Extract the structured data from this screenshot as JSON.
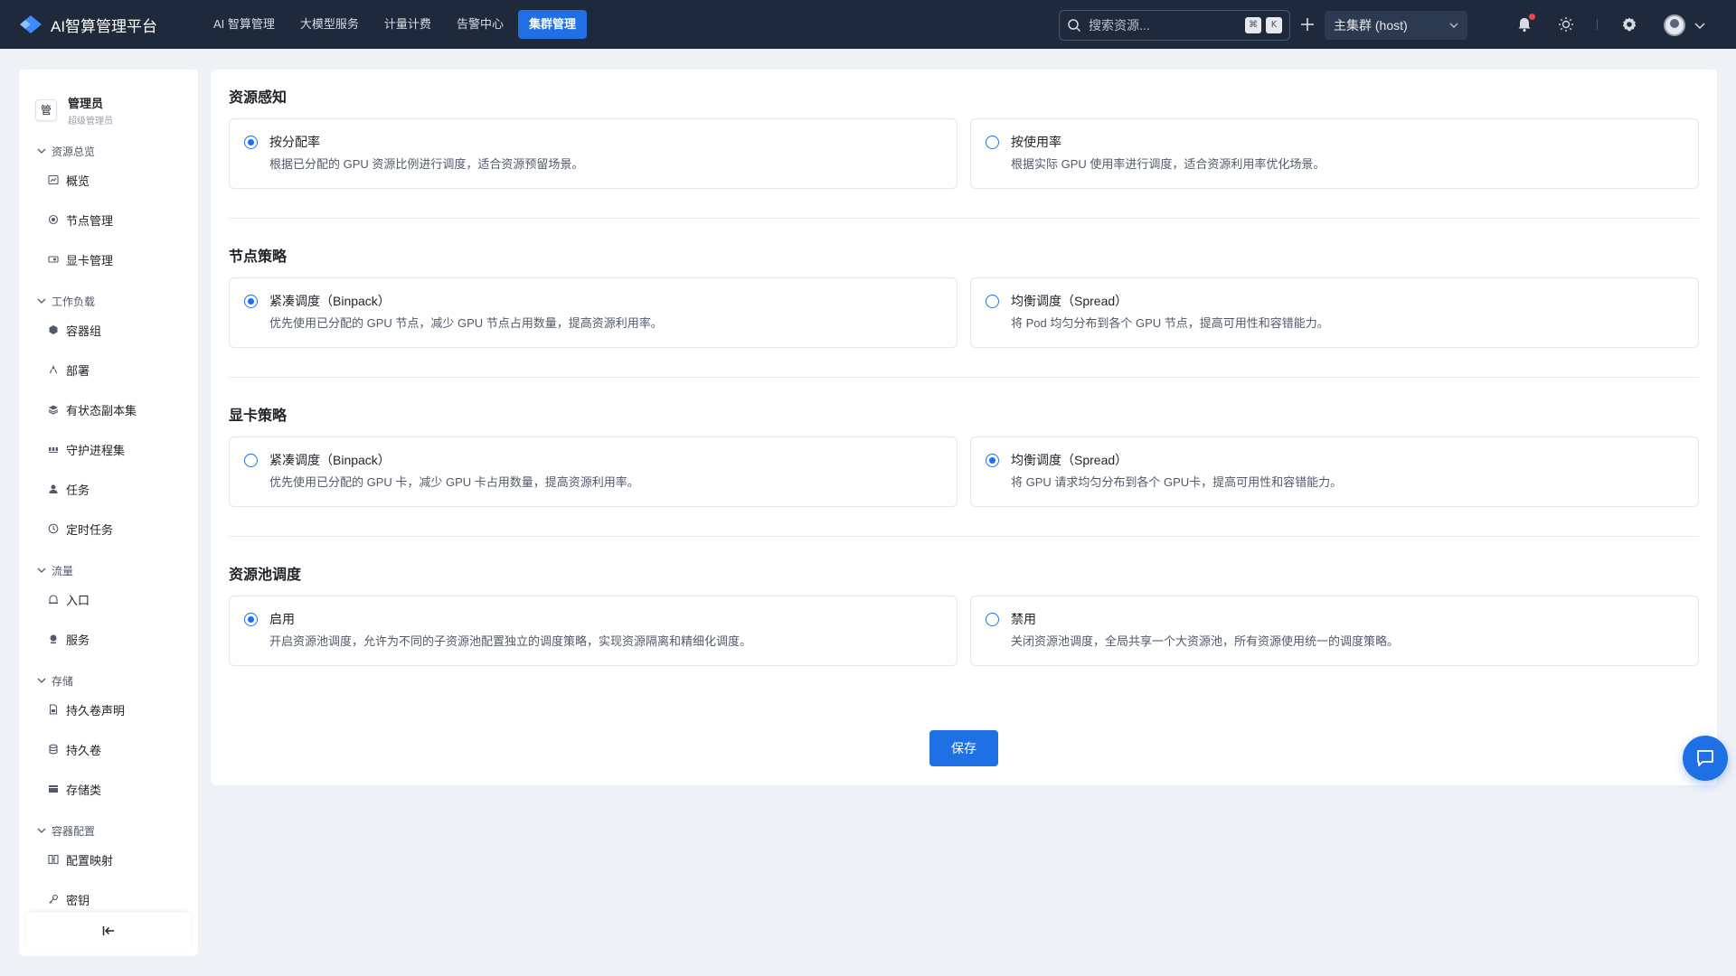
{
  "app": {
    "title": "AI智算管理平台"
  },
  "nav": [
    {
      "label": "AI 智算管理",
      "active": false
    },
    {
      "label": "大模型服务",
      "active": false
    },
    {
      "label": "计量计费",
      "active": false
    },
    {
      "label": "告警中心",
      "active": false
    },
    {
      "label": "集群管理",
      "active": true
    }
  ],
  "search": {
    "placeholder": "搜索资源...",
    "kbd1": "⌘",
    "kbd2": "K"
  },
  "cluster": {
    "selected": "主集群 (host)"
  },
  "user": {
    "avatar_text": "管",
    "name": "管理员",
    "role": "超级管理员"
  },
  "sidebar": {
    "groups": [
      {
        "title": "资源总览",
        "items": [
          {
            "label": "概览",
            "icon": "dashboard-icon"
          },
          {
            "label": "节点管理",
            "icon": "node-icon"
          },
          {
            "label": "显卡管理",
            "icon": "gpu-card-icon"
          }
        ]
      },
      {
        "title": "工作负载",
        "items": [
          {
            "label": "容器组",
            "icon": "cube-icon"
          },
          {
            "label": "部署",
            "icon": "rocket-icon"
          },
          {
            "label": "有状态副本集",
            "icon": "layers-icon"
          },
          {
            "label": "守护进程集",
            "icon": "daemon-icon"
          },
          {
            "label": "任务",
            "icon": "job-icon"
          },
          {
            "label": "定时任务",
            "icon": "clock-icon"
          }
        ]
      },
      {
        "title": "流量",
        "items": [
          {
            "label": "入口",
            "icon": "ingress-icon"
          },
          {
            "label": "服务",
            "icon": "service-icon"
          }
        ]
      },
      {
        "title": "存储",
        "items": [
          {
            "label": "持久卷声明",
            "icon": "pvc-icon"
          },
          {
            "label": "持久卷",
            "icon": "database-icon"
          },
          {
            "label": "存储类",
            "icon": "storage-class-icon"
          }
        ]
      },
      {
        "title": "容器配置",
        "items": [
          {
            "label": "配置映射",
            "icon": "configmap-icon"
          },
          {
            "label": "密钥",
            "icon": "key-icon"
          }
        ]
      }
    ]
  },
  "sections": [
    {
      "title": "资源感知",
      "options": [
        {
          "title": "按分配率",
          "desc": "根据已分配的 GPU 资源比例进行调度，适合资源预留场景。",
          "checked": true
        },
        {
          "title": "按使用率",
          "desc": "根据实际 GPU 使用率进行调度，适合资源利用率优化场景。",
          "checked": false
        }
      ]
    },
    {
      "title": "节点策略",
      "options": [
        {
          "title": "紧凑调度（Binpack）",
          "desc": "优先使用已分配的 GPU 节点，减少 GPU 节点占用数量，提高资源利用率。",
          "checked": true
        },
        {
          "title": "均衡调度（Spread）",
          "desc": "将 Pod 均匀分布到各个 GPU 节点，提高可用性和容错能力。",
          "checked": false
        }
      ]
    },
    {
      "title": "显卡策略",
      "options": [
        {
          "title": "紧凑调度（Binpack）",
          "desc": "优先使用已分配的 GPU 卡，减少 GPU 卡占用数量，提高资源利用率。",
          "checked": false
        },
        {
          "title": "均衡调度（Spread）",
          "desc": "将 GPU 请求均匀分布到各个 GPU卡，提高可用性和容错能力。",
          "checked": true
        }
      ]
    },
    {
      "title": "资源池调度",
      "options": [
        {
          "title": "启用",
          "desc": "开启资源池调度，允许为不同的子资源池配置独立的调度策略，实现资源隔离和精细化调度。",
          "checked": true
        },
        {
          "title": "禁用",
          "desc": "关闭资源池调度，全局共享一个大资源池，所有资源使用统一的调度策略。",
          "checked": false
        }
      ]
    }
  ],
  "actions": {
    "save_label": "保存"
  },
  "colors": {
    "primary": "#1f6fe5",
    "topbar": "#1e2a3c",
    "background": "#eef1f6",
    "notification": "#f04646"
  }
}
